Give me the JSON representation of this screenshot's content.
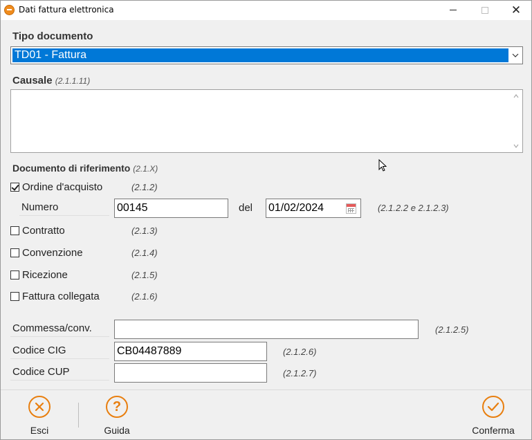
{
  "window": {
    "title": "Dati fattura elettronica"
  },
  "tipo_documento": {
    "label": "Tipo documento",
    "selected": "TD01 - Fattura"
  },
  "causale": {
    "label": "Causale",
    "ref": "(2.1.1.11)",
    "value": ""
  },
  "documento_riferimento": {
    "label": "Documento di riferimento",
    "ref": "(2.1.X)"
  },
  "ordine": {
    "label": "Ordine d'acquisto",
    "ref": "(2.1.2)",
    "checked": true,
    "numero_label": "Numero",
    "numero_value": "00145",
    "del_label": "del",
    "data_value": "01/02/2024",
    "date_ref": "(2.1.2.2 e 2.1.2.3)"
  },
  "contratto": {
    "label": "Contratto",
    "ref": "(2.1.3)",
    "checked": false
  },
  "convenzione": {
    "label": "Convenzione",
    "ref": "(2.1.4)",
    "checked": false
  },
  "ricezione": {
    "label": "Ricezione",
    "ref": "(2.1.5)",
    "checked": false
  },
  "fattura_collegata": {
    "label": "Fattura collegata",
    "ref": "(2.1.6)",
    "checked": false
  },
  "commessa": {
    "label": "Commessa/conv.",
    "value": "",
    "ref": "(2.1.2.5)"
  },
  "cig": {
    "label": "Codice CIG",
    "value": "CB04487889",
    "ref": "(2.1.2.6)"
  },
  "cup": {
    "label": "Codice CUP",
    "value": "",
    "ref": "(2.1.2.7)"
  },
  "toolbar": {
    "esci_label": "Esci",
    "guida_label": "Guida",
    "conferma_label": "Conferma"
  },
  "colors": {
    "accent": "#e87e0e",
    "selection": "#0078d7",
    "panel": "#f0f0f0"
  }
}
